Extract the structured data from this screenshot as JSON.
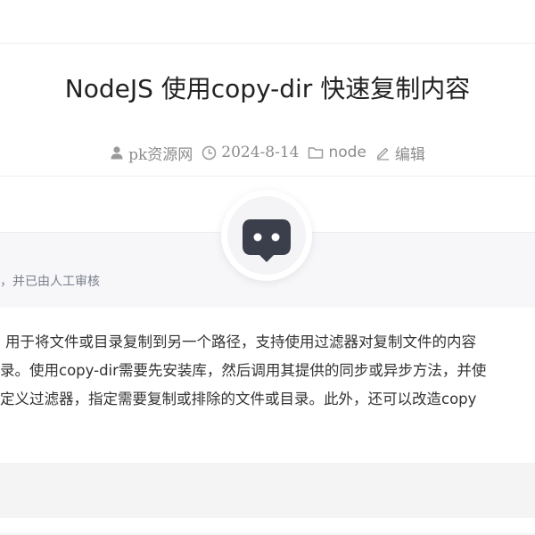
{
  "article": {
    "title": "NodeJS 使用copy-dir 快速复制内容",
    "meta": {
      "author": "pk资源网",
      "date": "2024-8-14",
      "category": "node",
      "edit_label": "编辑"
    }
  },
  "ai_summary": {
    "note": "，并已由人工审核",
    "lines": [
      "用于将文件或目录复制到另一个路径，支持使用过滤器对复制文件的内容",
      "录。使用copy-dir需要先安装库，然后调用其提供的同步或异步方法，并使",
      "定义过滤器，指定需要复制或排除的文件或目录。此外，还可以改造copy"
    ]
  },
  "icons": {
    "author": "user-icon",
    "date": "clock-icon",
    "category": "folder-icon",
    "edit": "edit-pencil-icon",
    "robot": "ai-robot-icon"
  },
  "colors": {
    "meta_text": "#8c8c8c",
    "summary_bg": "#f7f7fa",
    "robot_face": "#3b3f4c"
  }
}
